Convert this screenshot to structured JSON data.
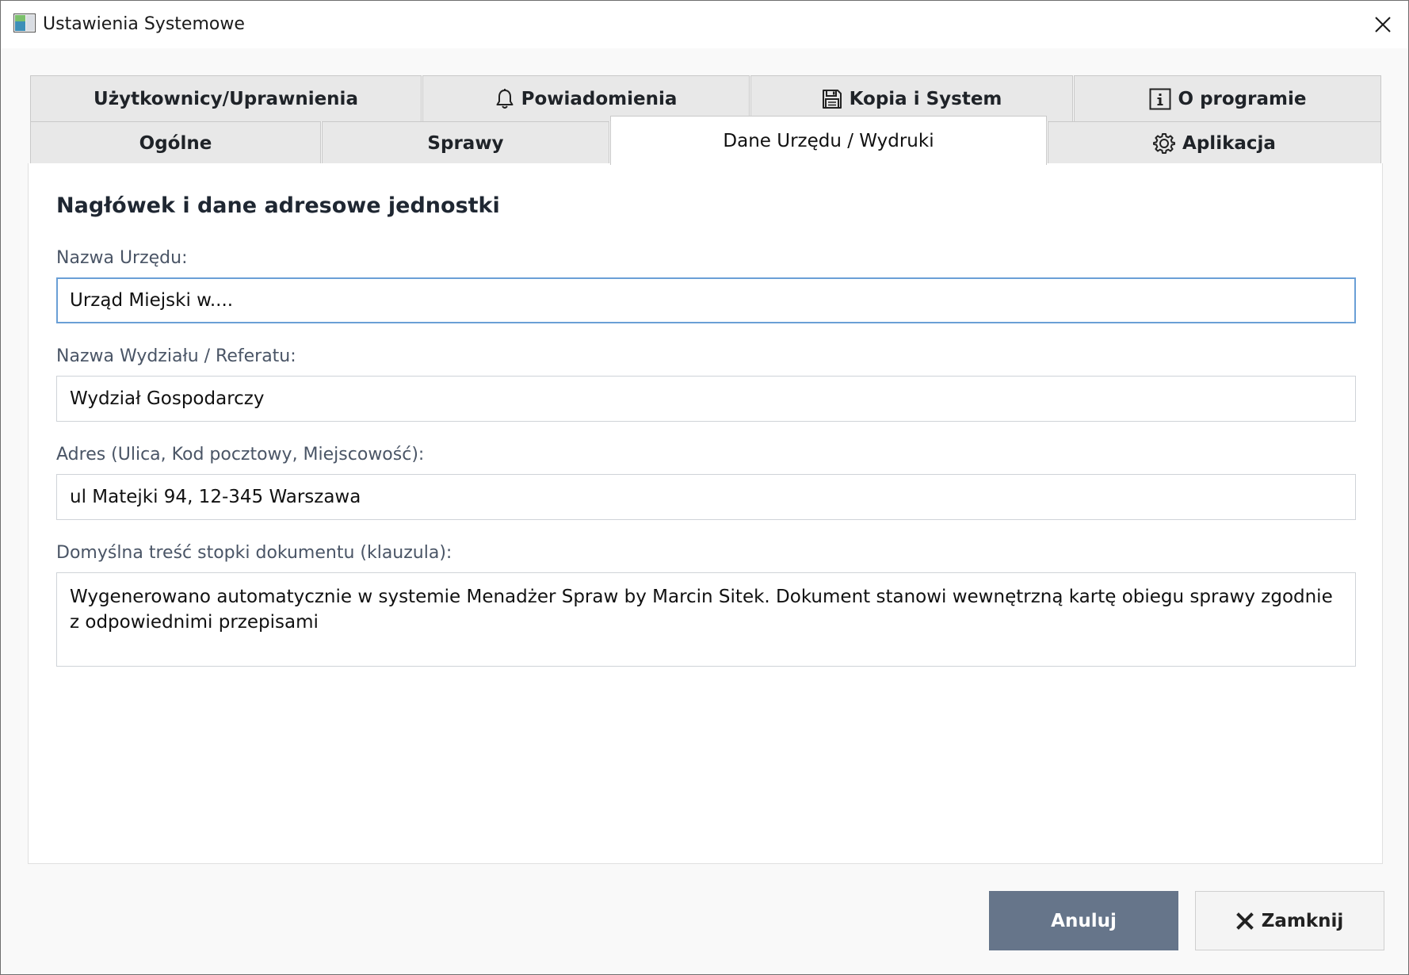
{
  "window": {
    "title": "Ustawienia Systemowe"
  },
  "tabs": {
    "row1": [
      {
        "label": "Użytkownicy/Uprawnienia",
        "icon": null
      },
      {
        "label": "Powiadomienia",
        "icon": "bell-icon"
      },
      {
        "label": "Kopia i System",
        "icon": "floppy-disk-icon"
      },
      {
        "label": "O programie",
        "icon": "info-icon"
      }
    ],
    "row2": [
      {
        "label": "Ogólne",
        "icon": null
      },
      {
        "label": "Sprawy",
        "icon": null
      },
      {
        "label": "Dane Urzędu / Wydruki",
        "icon": null,
        "active": true
      },
      {
        "label": "Aplikacja",
        "icon": "gear-icon"
      }
    ]
  },
  "section": {
    "title": "Nagłówek i dane adresowe jednostki"
  },
  "fields": {
    "office_name": {
      "label": "Nazwa Urzędu:",
      "value": "Urząd Miejski w...."
    },
    "department": {
      "label": "Nazwa Wydziału / Referatu:",
      "value": "Wydział Gospodarczy"
    },
    "address": {
      "label": "Adres (Ulica, Kod pocztowy, Miejscowość):",
      "value": "ul Matejki 94, 12-345 Warszawa"
    },
    "footer": {
      "label": "Domyślna treść stopki dokumentu (klauzula):",
      "value": "Wygenerowano automatycznie w systemie Menadżer Spraw by Marcin Sitek. Dokument stanowi wewnętrzną kartę obiegu sprawy zgodnie z odpowiednimi przepisami"
    }
  },
  "buttons": {
    "cancel": "Anuluj",
    "close": "Zamknij"
  },
  "colors": {
    "cancel_button_bg": "#66758a",
    "focus_border": "#6a9fd6",
    "title_accent": "#1f3d7a"
  }
}
